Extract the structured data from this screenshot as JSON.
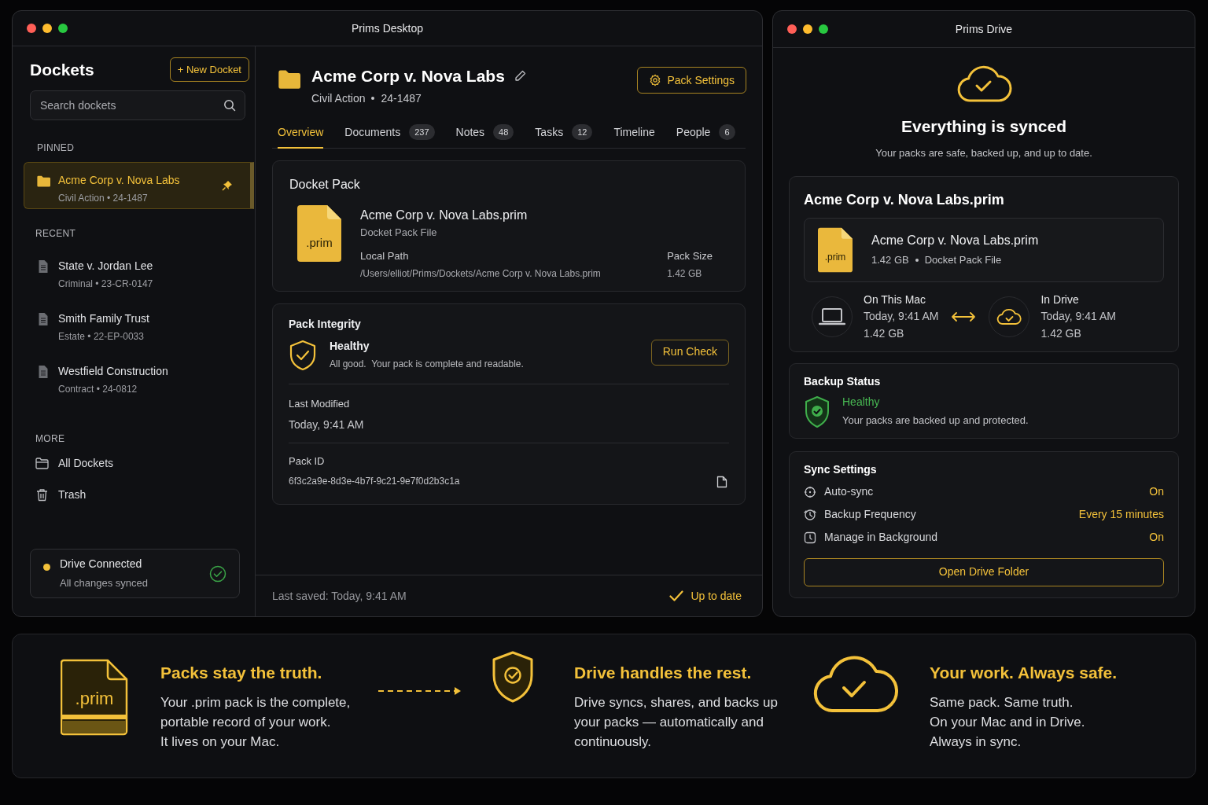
{
  "desktop_window": {
    "title": "Prims Desktop",
    "sidebar": {
      "title": "Dockets",
      "new_button": "+ New Docket",
      "search": {
        "placeholder": "Search dockets"
      },
      "pinned": {
        "heading": "PINNED",
        "items": [
          {
            "title": "Acme Corp v. Nova Labs",
            "subtitle": "Civil Action • 24-1487",
            "selected": true,
            "pinned": true
          }
        ]
      },
      "recent": {
        "heading": "RECENT",
        "items": [
          {
            "title": "State v. Jordan Lee",
            "subtitle": "Criminal • 23-CR-0147",
            "selected": false,
            "pinned": false
          },
          {
            "title": "Smith Family Trust",
            "subtitle": "Estate • 22-EP-0033",
            "selected": false,
            "pinned": false
          },
          {
            "title": "Westfield Construction",
            "subtitle": "Contract • 24-0812",
            "selected": false,
            "pinned": false
          }
        ]
      },
      "more": {
        "heading": "MORE",
        "items": [
          {
            "kind": "folder",
            "label": "All Dockets"
          },
          {
            "kind": "trash",
            "label": "Trash"
          }
        ]
      },
      "drive_status": {
        "title": "Drive Connected",
        "subtitle": "All changes synced",
        "connected": true
      }
    },
    "header": {
      "title": "Acme Corp v. Nova Labs",
      "case_type": "Civil Action",
      "case_number": "24-1487",
      "settings_button": "Pack Settings"
    },
    "tabs": [
      {
        "label": "Overview",
        "selected": true
      },
      {
        "label": "Documents",
        "count": "237",
        "selected": false
      },
      {
        "label": "Notes",
        "count": "48",
        "selected": false
      },
      {
        "label": "Tasks",
        "count": "12",
        "selected": false
      },
      {
        "label": "Timeline",
        "selected": false
      },
      {
        "label": "People",
        "count": "6",
        "selected": false
      }
    ],
    "docket_pack": {
      "heading": "Docket Pack",
      "file_extension": ".prim",
      "file_name": "Acme Corp v. Nova Labs.prim",
      "file_type": "Docket Pack File",
      "path_label": "Local Path",
      "path": "/Users/elliot/Prims/Dockets/Acme Corp v. Nova Labs.prim",
      "size_label": "Pack Size",
      "size": "1.42 GB"
    },
    "integrity": {
      "heading": "Pack Integrity",
      "status": "Healthy",
      "message": "All good.  Your pack is complete and readable.",
      "button": "Run Check",
      "modified_label": "Last Modified",
      "modified": "Today, 9:41 AM",
      "id_label": "Pack ID",
      "id": "6f3c2a9e-8d3e-4b7f-9c21-9e7f0d2b3c1a"
    },
    "footer": {
      "last_saved": "Last saved: Today, 9:41 AM",
      "status": "Up to date"
    }
  },
  "drive_window": {
    "title": "Prims Drive",
    "headline": "Everything is synced",
    "subline": "Your packs are safe, backed up, and up to date.",
    "pack": {
      "heading": "Acme Corp v. Nova Labs.prim",
      "file_extension": ".prim",
      "file_name": "Acme Corp v. Nova Labs.prim",
      "size": "1.42 GB",
      "file_type": "Docket Pack File",
      "locations": [
        {
          "kind": "mac",
          "label": "On This Mac",
          "time": "Today, 9:41 AM",
          "size": "1.42 GB"
        },
        {
          "kind": "drive",
          "label": "In Drive",
          "time": "Today, 9:41 AM",
          "size": "1.42 GB"
        }
      ]
    },
    "backup": {
      "heading": "Backup Status",
      "status": "Healthy",
      "message": "Your packs are backed up and protected."
    },
    "sync": {
      "heading": "Sync Settings",
      "rows": [
        {
          "kind": "sync",
          "label": "Auto-sync",
          "value": "On"
        },
        {
          "kind": "frequency",
          "label": "Backup Frequency",
          "value": "Every 15 minutes"
        },
        {
          "kind": "background",
          "label": "Manage in Background",
          "value": "On"
        }
      ],
      "button": "Open Drive Folder"
    }
  },
  "features": [
    {
      "kind": "pack",
      "file_extension": ".prim",
      "title": "Packs stay the truth.",
      "lines": [
        "Your .prim pack is the complete,",
        "portable record of your work.",
        "It lives on your Mac."
      ]
    },
    {
      "kind": "shield",
      "title": "Drive handles the rest.",
      "lines": [
        "Drive syncs, shares, and backs up",
        "your packs — automatically and",
        "continuously."
      ]
    },
    {
      "kind": "cloud",
      "title": "Your work. Always safe.",
      "lines": [
        "Same pack. Same truth.",
        "On your Mac and in Drive.",
        "Always in sync."
      ]
    }
  ]
}
